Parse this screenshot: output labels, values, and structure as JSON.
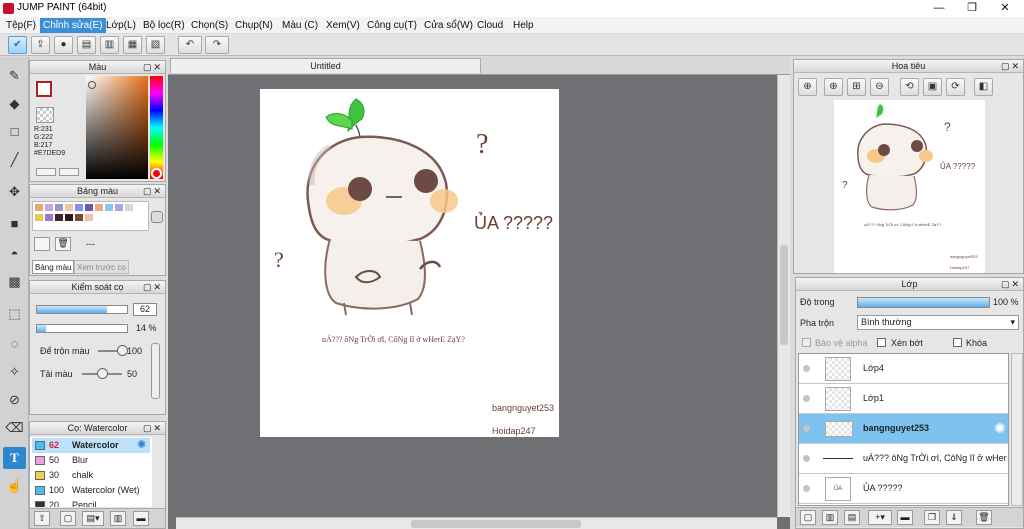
{
  "window": {
    "title": "JUMP PAINT (64bit)",
    "minimize": "—",
    "restore": "❐",
    "close": "✕"
  },
  "menu": [
    "Tệp(F)",
    "Chỉnh sửa(E)",
    "Lớp(L)",
    "Bộ lọc(R)",
    "Chọn(S)",
    "Chụp(N)",
    "Màu (C)",
    "Xem(V)",
    "Công cụ(T)",
    "Cửa sổ(W)",
    "Cloud",
    "Help"
  ],
  "color_panel": {
    "title": "Màu",
    "r": "R:231",
    "g": "G:222",
    "b": "B:217",
    "hex": "#E7DED9"
  },
  "palette_panel": {
    "title": "Bảng màu",
    "count": "---",
    "tab_palette": "Bảng màu",
    "tab_preview": "Xem trước cọ",
    "swatches": [
      "#e9a86f",
      "#c9a4d8",
      "#9999cc",
      "#f3c4a2",
      "#8c8cf0",
      "#6b5aa8",
      "#f1a67d",
      "#88c6ee",
      "#a8a8e0",
      "#d7d7d7",
      "#e7c95a",
      "#9b7bc7",
      "#3a2530",
      "#2a1c1e",
      "#7a4a3a",
      "#f2c2a8"
    ]
  },
  "brush_control": {
    "title": "Kiểm soát cọ",
    "size": "62",
    "size_frac": 0.78,
    "opacity": "14 %",
    "opacity_frac": 0.1,
    "blend_label": "Để trộn màu",
    "blend_value": "100",
    "blend_frac": 1.0,
    "paint_label": "Tải màu",
    "paint_value": "50",
    "paint_frac": 0.5
  },
  "brush_panel": {
    "title": "Cọ: Watercolor",
    "items": [
      {
        "size": "62",
        "name": "Watercolor",
        "color": "#49c0f0"
      },
      {
        "size": "50",
        "name": "Blur",
        "color": "#f0a0e0"
      },
      {
        "size": "30",
        "name": "chalk",
        "color": "#f0d050"
      },
      {
        "size": "100",
        "name": "Watercolor (Wet)",
        "color": "#49c0f0"
      },
      {
        "size": "20",
        "name": "Pencil",
        "color": "#333333"
      }
    ]
  },
  "canvas": {
    "tab_title": "Untitled",
    "art_text_main": "ỦA ?????",
    "art_text_caption": "uÁ??? ôNg TrỜi ơI, CôNg Iĩ ở wHerE ZạY?",
    "art_q1": "?",
    "art_q2": "?",
    "art_signature": "bangnguyet253",
    "art_watermark": "Hoidap247"
  },
  "navigator": {
    "title": "Hoa tiêu",
    "thumb_text": "ỦA ?????",
    "thumb_caption": "uÁ??? ôNg TrỜi ơI, CôNg Iĩ ở wHerE ZạY?",
    "thumb_sig": "bangnguyet253",
    "thumb_wm": "Hoidap247"
  },
  "layer_panel": {
    "title": "Lớp",
    "opacity_label": "Độ trong",
    "opacity_value": "100 %",
    "opacity_frac": 1.0,
    "blend_label": "Pha trộn",
    "blend_value": "Bình thường",
    "protect_alpha": "Bảo vệ alpha",
    "clip": "Xén bớt",
    "lock": "Khóa",
    "layers": [
      {
        "name": "Lớp4"
      },
      {
        "name": "Lớp1"
      },
      {
        "name": "bangnguyet253"
      },
      {
        "name": "uÁ??? ôNg TrỜi ơI, CôNg Iĩ ở wHer"
      },
      {
        "name": "ỦA ?????"
      }
    ]
  },
  "icons": {
    "check": "✔",
    "settings": "✺",
    "dropdown": "▾",
    "undo": "↶",
    "redo": "↷"
  }
}
